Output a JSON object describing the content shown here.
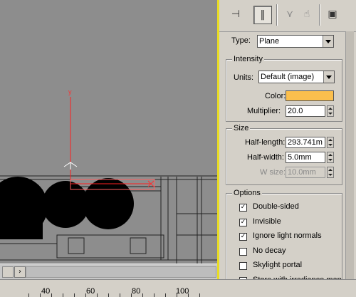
{
  "ruler": {
    "labels": [
      "40",
      "60",
      "80",
      "100"
    ]
  },
  "viewport": {
    "axis_label": "y"
  },
  "hscroll": {
    "arrow_icon": "arrow-right-icon"
  },
  "toolbar": {
    "buttons": [
      {
        "icon": "pin-stack-icon",
        "glyph": "⊣"
      },
      {
        "icon": "modifier-stack-active-icon",
        "glyph": "‖"
      },
      {
        "icon": "make-unique-icon",
        "glyph": "⋎"
      },
      {
        "icon": "remove-modifier-icon",
        "glyph": "☝"
      },
      {
        "icon": "configure-modifier-sets-icon",
        "glyph": "▣"
      }
    ]
  },
  "type_row": {
    "label": "Type:",
    "value": "Plane"
  },
  "intensity": {
    "title": "Intensity",
    "units_label": "Units:",
    "units_value": "Default (image)",
    "color_label": "Color:",
    "color_hex": "#fbbf4d",
    "multiplier_label": "Multiplier:",
    "multiplier_value": "20.0"
  },
  "size": {
    "title": "Size",
    "half_length_label": "Half-length:",
    "half_length_value": "293.741m",
    "half_width_label": "Half-width:",
    "half_width_value": "5.0mm",
    "w_size_label": "W size:",
    "w_size_value": "10.0mm"
  },
  "options": {
    "title": "Options",
    "items": [
      {
        "label": "Double-sided",
        "checked": true
      },
      {
        "label": "Invisible",
        "checked": true
      },
      {
        "label": "Ignore light normals",
        "checked": true
      },
      {
        "label": "No decay",
        "checked": false
      },
      {
        "label": "Skylight portal",
        "checked": false
      },
      {
        "label": "Store with irradiance map",
        "checked": false
      }
    ]
  }
}
